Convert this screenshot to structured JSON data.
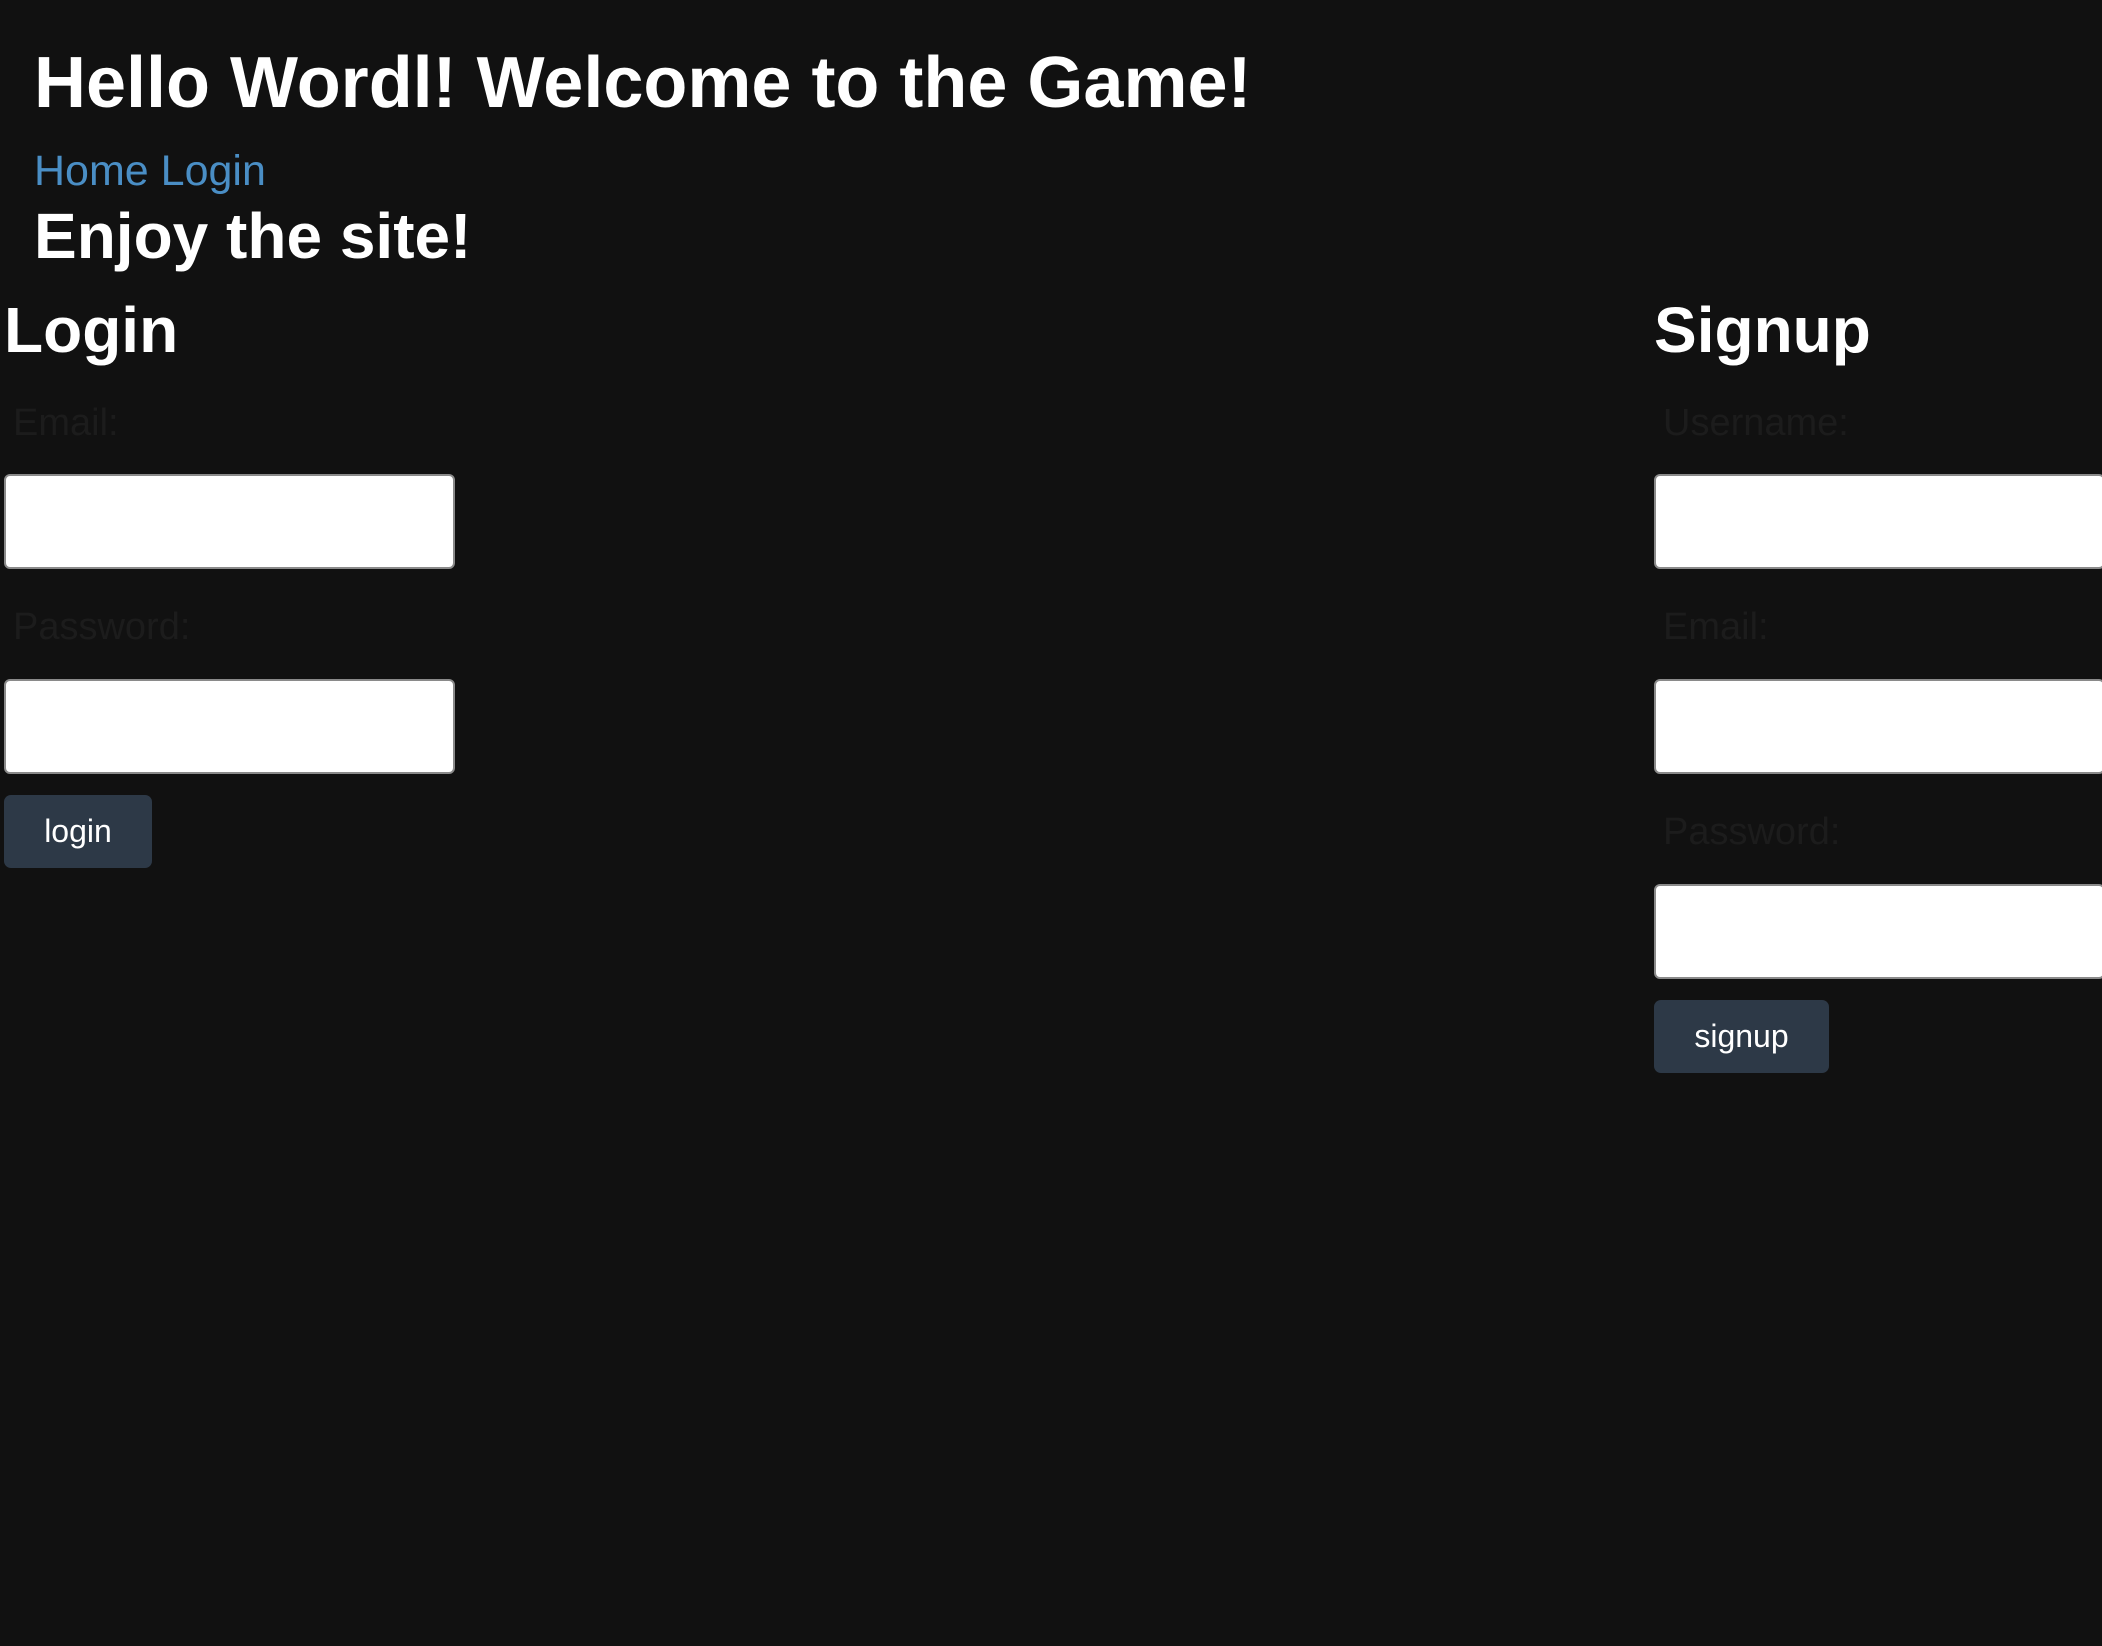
{
  "header": {
    "title": "Hello Wordl! Welcome to the Game!",
    "nav": {
      "home_label": "Home",
      "login_label": "Login"
    },
    "subtitle": "Enjoy the site!"
  },
  "login_form": {
    "heading": "Login",
    "email_label": "Email:",
    "email_value": "",
    "password_label": "Password:",
    "password_value": "",
    "submit_label": "login"
  },
  "signup_form": {
    "heading": "Signup",
    "username_label": "Username:",
    "username_value": "",
    "email_label": "Email:",
    "email_value": "",
    "password_label": "Password:",
    "password_value": "",
    "submit_label": "signup"
  },
  "colors": {
    "background": "#111111",
    "link": "#4a8ec5",
    "button": "#2d3947",
    "label_text": "#1c1c1c"
  }
}
